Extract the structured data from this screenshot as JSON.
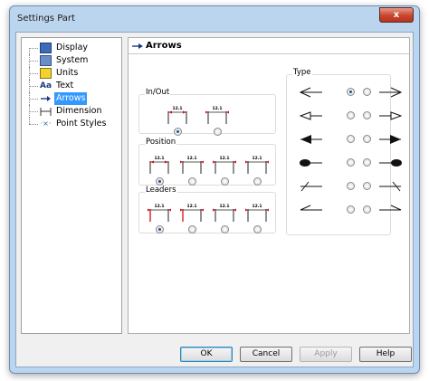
{
  "window": {
    "title": "Settings Part",
    "close_label": "x"
  },
  "tree": {
    "items": [
      {
        "label": "Display"
      },
      {
        "label": "System"
      },
      {
        "label": "Units"
      },
      {
        "label": "Text"
      },
      {
        "label": "Arrows"
      },
      {
        "label": "Dimension"
      },
      {
        "label": "Point Styles"
      }
    ],
    "selected": "Arrows"
  },
  "panel": {
    "title": "Arrows",
    "groups": {
      "inout": {
        "label": "In/Out",
        "selected_index": 0,
        "option_count": 2
      },
      "position": {
        "label": "Position",
        "selected_index": 0,
        "option_count": 4
      },
      "leaders": {
        "label": "Leaders",
        "selected_index": 0,
        "option_count": 4
      },
      "type": {
        "label": "Type",
        "rows": [
          {
            "left": "open-arrow",
            "right": "open-arrow",
            "selected": "left"
          },
          {
            "left": "closed-arrow",
            "right": "closed-arrow",
            "selected": "none"
          },
          {
            "left": "filled-arrow",
            "right": "filled-arrow",
            "selected": "none"
          },
          {
            "left": "filled-dot",
            "right": "filled-dot",
            "selected": "none"
          },
          {
            "left": "slash",
            "right": "slash",
            "selected": "none"
          },
          {
            "left": "half-arrow",
            "right": "half-arrow",
            "selected": "none"
          }
        ]
      }
    },
    "dim_text": "12.1"
  },
  "buttons": {
    "ok": "OK",
    "cancel": "Cancel",
    "apply": "Apply",
    "help": "Help"
  },
  "colors": {
    "selection": "#3399ff",
    "leader_red": "#d01010",
    "frame": "#bcd5ee"
  }
}
